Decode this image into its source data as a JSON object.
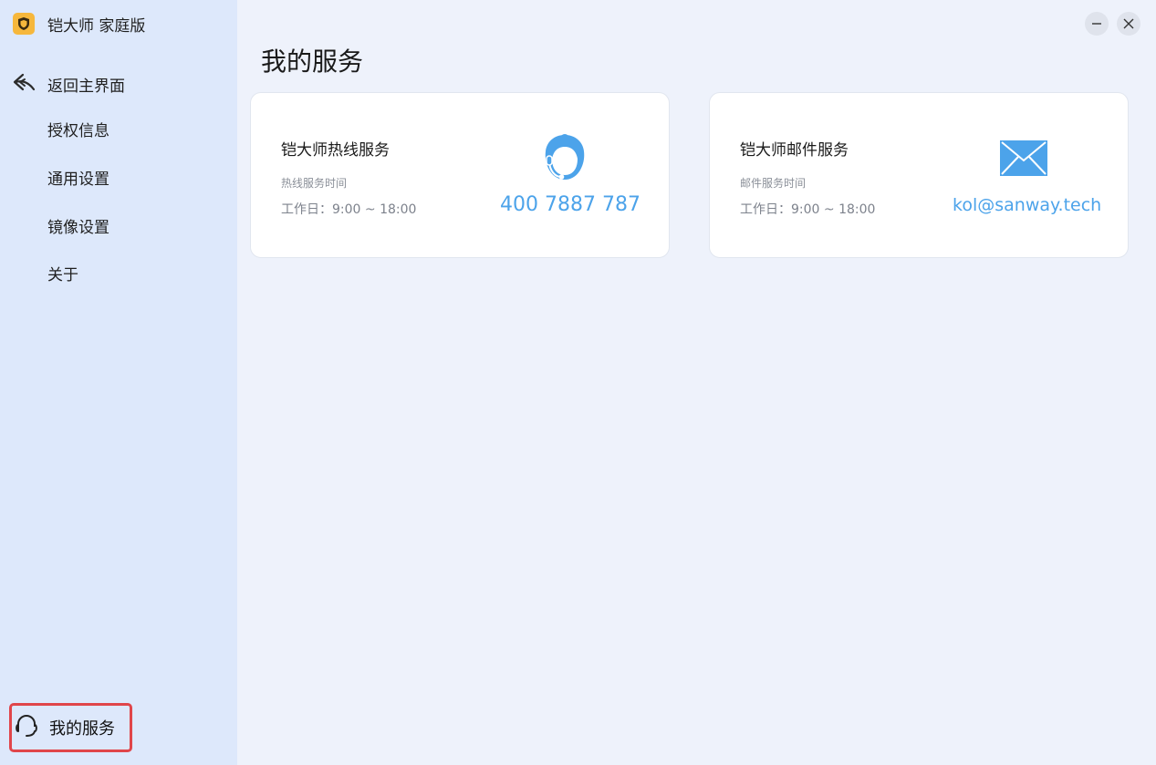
{
  "app": {
    "title": "铠大师 家庭版",
    "accent_color": "#4ca3ea",
    "logo_color": "#f6b73c",
    "highlight_color": "#e0454a"
  },
  "sidebar": {
    "back_label": "返回主界面",
    "items": [
      {
        "label": "授权信息"
      },
      {
        "label": "通用设置"
      },
      {
        "label": "镜像设置"
      },
      {
        "label": "关于"
      }
    ],
    "service_label": "我的服务",
    "icons": {
      "back": "back-arrow-icon",
      "service": "headset-icon",
      "logo": "shield-logo-icon"
    }
  },
  "window_controls": {
    "minimize": "minimize-icon",
    "close": "close-icon"
  },
  "main": {
    "title": "我的服务",
    "cards": [
      {
        "title": "铠大师热线服务",
        "subtitle": "热线服务时间",
        "hours": "工作日：9:00 ~ 18:00",
        "value": "400 7887 787",
        "icon": "customer-service-icon"
      },
      {
        "title": "铠大师邮件服务",
        "subtitle": "邮件服务时间",
        "hours": "工作日：9:00 ~ 18:00",
        "value": "kol@sanway.tech",
        "icon": "envelope-icon"
      }
    ]
  }
}
